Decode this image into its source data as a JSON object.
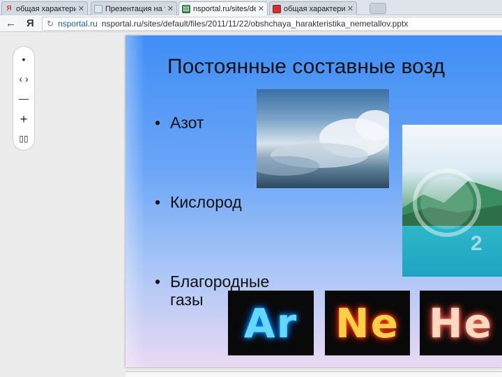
{
  "browser": {
    "tabs": [
      {
        "label": "общая характеристи",
        "favicon": "yandex-icon",
        "active": false
      },
      {
        "label": "Презентация на тему",
        "favicon": "slides-icon",
        "active": false
      },
      {
        "label": "nsportal.ru/sites/defa",
        "favicon": "doc-icon",
        "active": true
      },
      {
        "label": "общая характеристи",
        "favicon": "slides-icon",
        "active": false
      }
    ],
    "yandex_label": "Я",
    "address": {
      "domain": "nsportal.ru",
      "url": "nsportal.ru/sites/default/files/2011/11/22/obshchaya_harakteristika_nemetallov.pptx"
    }
  },
  "viewer": {
    "controls": [
      "•",
      "‹ ›",
      "—",
      "+",
      "▯▯"
    ]
  },
  "slide": {
    "title": "Постоянные составные возд",
    "bullets": [
      "Азот",
      "Кислород",
      "Благородные газы"
    ],
    "images": [
      {
        "name": "sky-clouds-photo"
      },
      {
        "name": "mountain-lake-photo",
        "overlay_number": "2"
      }
    ],
    "neon_labels": [
      "Ar",
      "Ne",
      "He"
    ]
  }
}
